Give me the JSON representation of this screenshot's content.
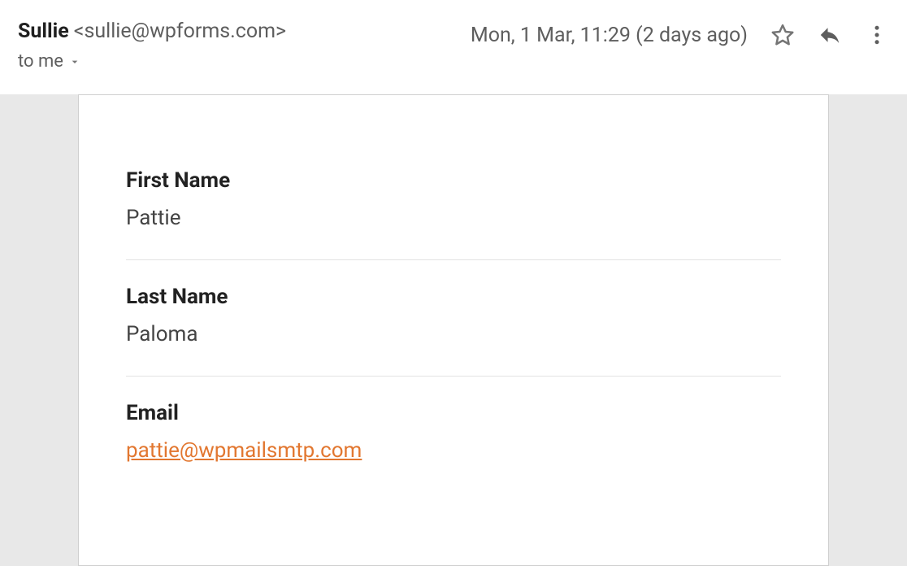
{
  "header": {
    "sender_name": "Sullie",
    "sender_email": "<sullie@wpforms.com>",
    "to_label": "to me",
    "date_text": "Mon, 1 Mar, 11:29 (2 days ago)"
  },
  "body": {
    "fields": [
      {
        "label": "First Name",
        "value": "Pattie"
      },
      {
        "label": "Last Name",
        "value": "Paloma"
      },
      {
        "label": "Email",
        "value": "pattie@wpmailsmtp.com",
        "is_link": true
      }
    ]
  },
  "colors": {
    "link": "#e27730",
    "body_bg": "#e8e8e8",
    "text_primary": "#1f1f1f",
    "text_secondary": "#5e5e5e"
  }
}
